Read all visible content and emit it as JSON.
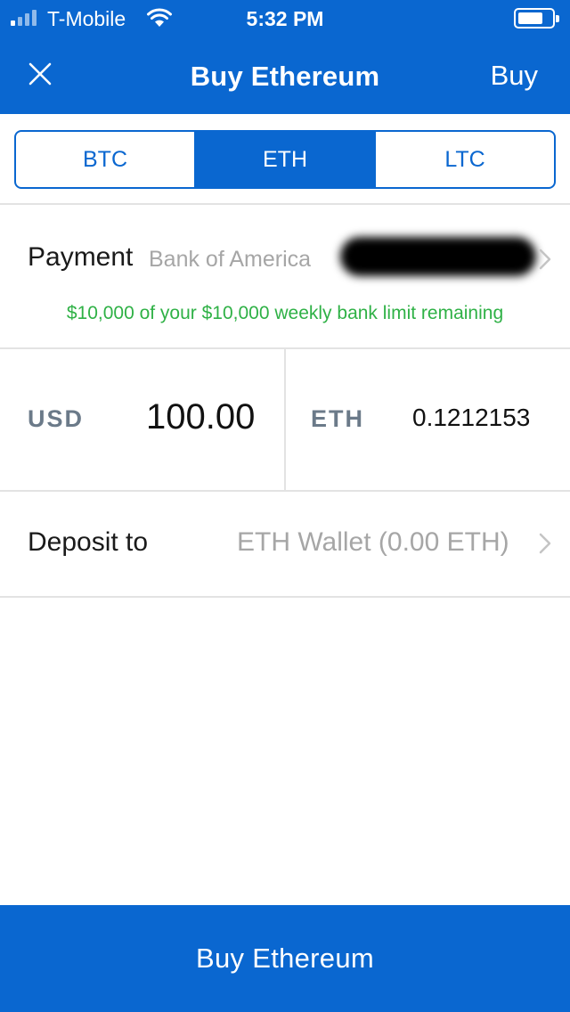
{
  "status_bar": {
    "carrier": "T-Mobile",
    "time": "5:32 PM"
  },
  "nav": {
    "title": "Buy Ethereum",
    "action_label": "Buy",
    "close_icon": "close-icon"
  },
  "segments": [
    {
      "label": "BTC",
      "active": false
    },
    {
      "label": "ETH",
      "active": true
    },
    {
      "label": "LTC",
      "active": false
    }
  ],
  "payment": {
    "label": "Payment",
    "value": "Bank of America",
    "limit_text": "$10,000 of your $10,000 weekly bank limit remaining"
  },
  "amount": {
    "fiat_code": "USD",
    "fiat_value": "100.00",
    "crypto_code": "ETH",
    "crypto_value": "0.1212153"
  },
  "deposit": {
    "label": "Deposit to",
    "value": "ETH Wallet (0.00 ETH)"
  },
  "buy_button": {
    "label": "Buy Ethereum"
  },
  "colors": {
    "brand": "#0a67d0",
    "limit_green": "#2fb146",
    "muted_text": "#a6a6a6",
    "code_gray": "#6b7a89"
  }
}
